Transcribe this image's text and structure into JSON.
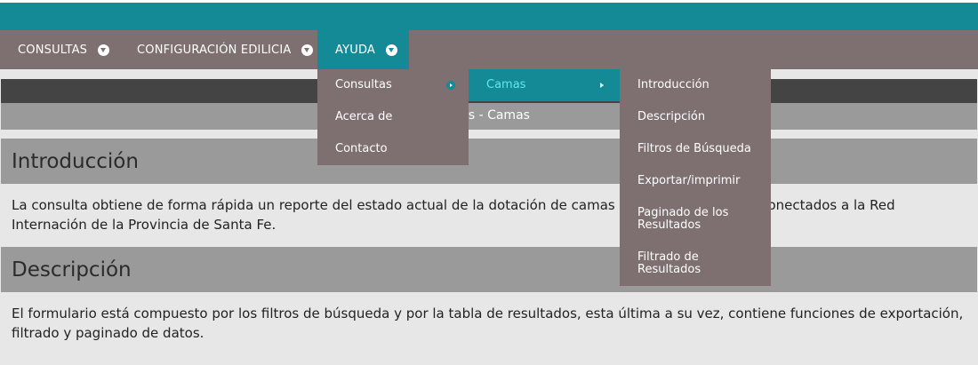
{
  "nav": {
    "items": [
      {
        "label": "CONSULTAS"
      },
      {
        "label": "CONFIGURACIÓN EDILICIA"
      },
      {
        "label": "AYUDA"
      }
    ]
  },
  "breadcrumb": {
    "text": "ultas - Camas"
  },
  "dropdown": {
    "level1": [
      {
        "label": "Consultas"
      },
      {
        "label": "Acerca de"
      },
      {
        "label": "Contacto"
      }
    ],
    "level2": [
      {
        "label": "Camas"
      }
    ],
    "level3": [
      {
        "label": "Introducción"
      },
      {
        "label": "Descripción"
      },
      {
        "label": "Filtros de Búsqueda"
      },
      {
        "label": "Exportar/imprimir"
      },
      {
        "label": "Paginado de los Resultados"
      },
      {
        "label": "Filtrado de Resultados"
      }
    ]
  },
  "sections": [
    {
      "title": "Introducción",
      "body": "La consulta obtiene de forma rápida un reporte del estado actual de la dotación de camas de los efectores interconectados a la Red Internación de la Provincia de Santa Fe."
    },
    {
      "title": "Descripción",
      "body": "El formulario está compuesto por los filtros de búsqueda y por la tabla de resultados, esta última a su vez, contiene funciones de exportación, filtrado y paginado de datos."
    }
  ],
  "colors": {
    "teal": "#148a96",
    "nav_bg": "#7e7070",
    "section_head": "#9a9a9a",
    "body_bg": "#e7e7e7"
  }
}
